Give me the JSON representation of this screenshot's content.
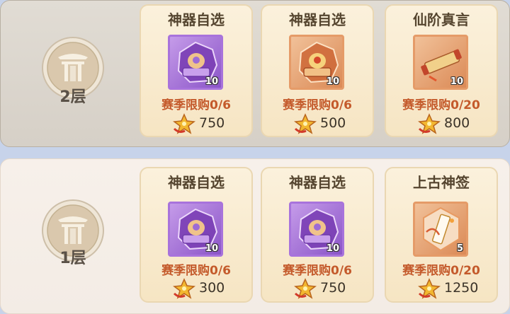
{
  "currency_icon": "gold-star-coin-icon",
  "floors": [
    {
      "label": "2层",
      "emblem_icon": "gate-emblem-icon",
      "items": [
        {
          "title": "神器自选",
          "limit": "赛季限购0/6",
          "price": "750",
          "count": "10",
          "frame": "purple",
          "icon": "purple-artifact-chest-icon"
        },
        {
          "title": "神器自选",
          "limit": "赛季限购0/6",
          "price": "500",
          "count": "10",
          "frame": "orange",
          "icon": "orange-artifact-chest-icon"
        },
        {
          "title": "仙阶真言",
          "limit": "赛季限购0/20",
          "price": "800",
          "count": "10",
          "frame": "orange",
          "icon": "scroll-icon"
        }
      ]
    },
    {
      "label": "1层",
      "emblem_icon": "gate-emblem-icon",
      "items": [
        {
          "title": "神器自选",
          "limit": "赛季限购0/6",
          "price": "300",
          "count": "10",
          "frame": "purple",
          "icon": "purple-artifact-chest-icon"
        },
        {
          "title": "神器自选",
          "limit": "赛季限购0/6",
          "price": "750",
          "count": "10",
          "frame": "purple",
          "icon": "purple-artifact-chest-icon"
        },
        {
          "title": "上古神签",
          "limit": "赛季限购0/20",
          "price": "1250",
          "count": "5",
          "frame": "orange",
          "icon": "talisman-icon"
        }
      ]
    }
  ]
}
